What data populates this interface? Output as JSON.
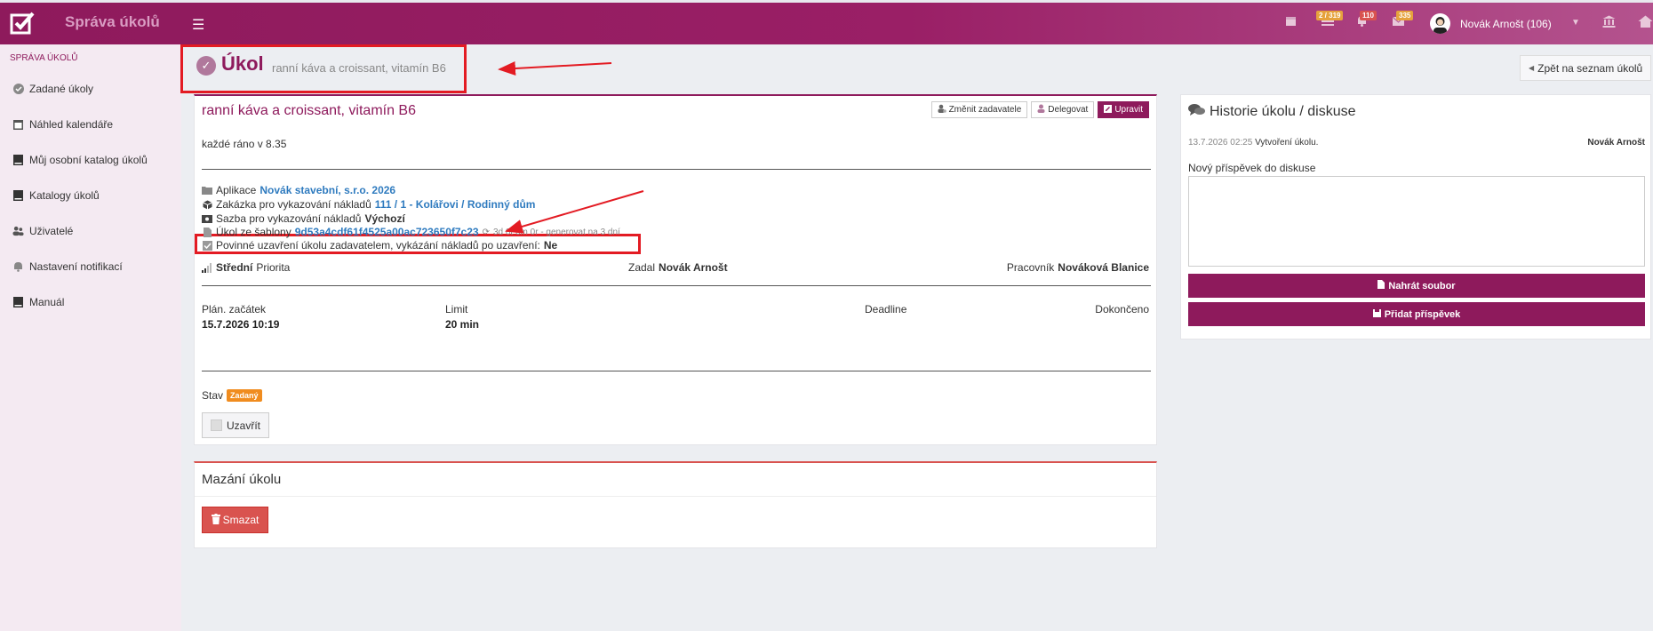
{
  "app": {
    "brand": "Správa úkolů"
  },
  "topbar": {
    "badges": {
      "tasks": "2 / 319",
      "notifications": "110",
      "mail": "335"
    },
    "user": "Novák Arnošt (106)"
  },
  "sidebar": {
    "header": "SPRÁVA ÚKOLŮ",
    "items": [
      {
        "label": "Zadané úkoly"
      },
      {
        "label": "Náhled kalendáře"
      },
      {
        "label": "Můj osobní katalog úkolů"
      },
      {
        "label": "Katalogy úkolů"
      },
      {
        "label": "Uživatelé"
      },
      {
        "label": "Nastavení notifikací"
      },
      {
        "label": "Manuál"
      }
    ]
  },
  "header": {
    "title": "Úkol",
    "subtitle": "ranní káva a croissant, vitamín B6",
    "back_label": "Zpět na seznam úkolů"
  },
  "task": {
    "title": "ranní káva a croissant, vitamín B6",
    "buttons": {
      "change_assigner": "Změnit zadavatele",
      "delegate": "Delegovat",
      "edit": "Upravit"
    },
    "description": "každé ráno v 8.35",
    "app_label": "Aplikace",
    "app_value": "Novák stavební, s.r.o. 2026",
    "order_label": "Zakázka pro vykazování nákladů",
    "order_value": "111 / 1 - Kolářovi / Rodinný dům",
    "rate_label": "Sazba pro vykazování nákladů",
    "rate_value": "Výchozí",
    "template_label": "Úkol ze šablony",
    "template_value": "9d53a4cdf61f4525a00ac723650f7c23",
    "template_repeat": "3d 0t 0m 0r - generovat na 3 dní",
    "mandatory_label": "Povinné uzavření úkolu zadavatelem, vykázání nákladů po uzavření:",
    "mandatory_value": "Ne",
    "priority_value": "Střední",
    "priority_label": "Priorita",
    "assigner_label": "Zadal",
    "assigner_value": "Novák Arnošt",
    "worker_label": "Pracovník",
    "worker_value": "Nováková Blanice",
    "plan_start_label": "Plán. začátek",
    "plan_start_value": "15.7.2026 10:19",
    "limit_label": "Limit",
    "limit_value": "20 min",
    "deadline_label": "Deadline",
    "done_label": "Dokončeno",
    "status_label": "Stav",
    "status_value": "Zadaný",
    "close_label": "Uzavřít"
  },
  "delete": {
    "title": "Mazání úkolu",
    "button": "Smazat"
  },
  "history": {
    "title": "Historie úkolu / diskuse",
    "entries": [
      {
        "date": "13.7.2026 02:25",
        "text": "Vytvoření úkolu.",
        "user": "Novák Arnošt"
      }
    ],
    "new_post_label": "Nový příspěvek do diskuse",
    "upload_label": "Nahrát soubor",
    "add_label": "Přidat příspěvek"
  },
  "colors": {
    "brand": "#8e1a5c",
    "annotation": "#e31b23",
    "status": "#f08c1f",
    "danger": "#d9534f"
  }
}
